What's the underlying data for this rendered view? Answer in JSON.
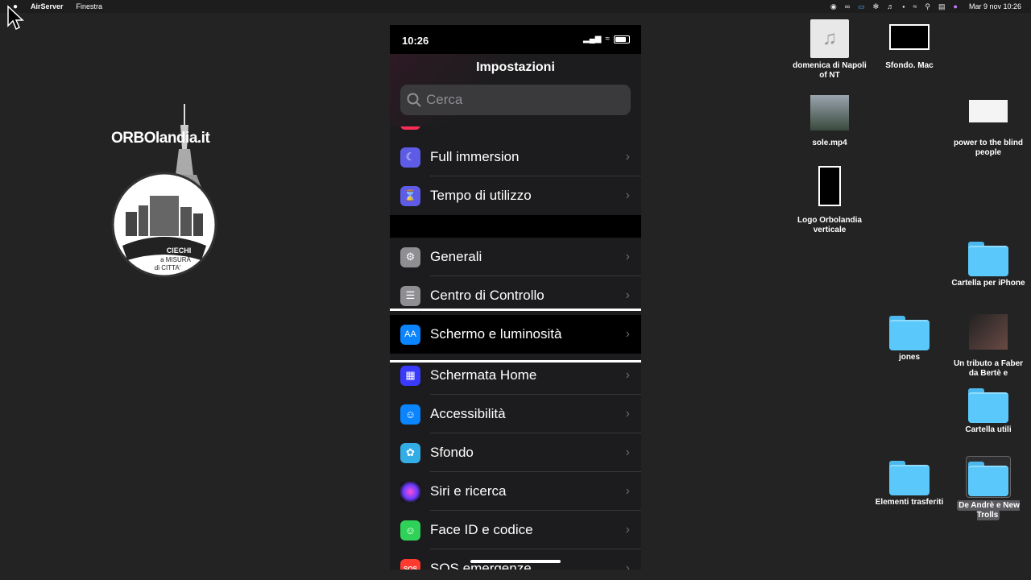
{
  "menubar": {
    "app_name": "AirServer",
    "menu_items": [
      "Finestra"
    ],
    "clock": "Mar 9 nov  10:26"
  },
  "logo": {
    "title": "ORBOlandia.it",
    "badge_line1": "CIECHI",
    "badge_line2": "a  MISURA",
    "badge_line3": "di  CITTA'"
  },
  "phone": {
    "time": "10:26",
    "nav_title": "Impostazioni",
    "search_placeholder": "Cerca",
    "rows": [
      {
        "label": "Full immersion",
        "icon": "moon-icon",
        "color": "#5e5ce6"
      },
      {
        "label": "Tempo di utilizzo",
        "icon": "hourglass-icon",
        "color": "#5e5ce6"
      },
      {
        "label": "Generali",
        "icon": "gear-icon",
        "color": "#8e8e93"
      },
      {
        "label": "Centro di Controllo",
        "icon": "toggles-icon",
        "color": "#8e8e93"
      },
      {
        "label": "Schermo e luminosità",
        "icon": "text-size-icon",
        "color": "#0a84ff"
      },
      {
        "label": "Schermata Home",
        "icon": "grid-icon",
        "color": "#3a3aff"
      },
      {
        "label": "Accessibilità",
        "icon": "accessibility-icon",
        "color": "#0a84ff"
      },
      {
        "label": "Sfondo",
        "icon": "flower-icon",
        "color": "#32ade6"
      },
      {
        "label": "Siri e ricerca",
        "icon": "siri-icon",
        "color": "#1c1c1e"
      },
      {
        "label": "Face ID e codice",
        "icon": "face-id-icon",
        "color": "#30d158"
      },
      {
        "label": "SOS emergenze",
        "icon": "sos-icon",
        "color": "#ff3b30"
      }
    ]
  },
  "desktop": {
    "icons": [
      {
        "label": "domenica di Napoli of NT"
      },
      {
        "label": "Sfondo. Mac"
      },
      {
        "label": "sole.mp4"
      },
      {
        "label": "power to the blind people"
      },
      {
        "label": "Logo Orbolandia verticale"
      },
      {
        "label": "Cartella per iPhone"
      },
      {
        "label": "jones"
      },
      {
        "label": "Un tributo a Faber da Bertè e"
      },
      {
        "label": "Cartella utili"
      },
      {
        "label": "Elementi trasferiti"
      },
      {
        "label": "De Andrè e New Trolls"
      }
    ]
  }
}
